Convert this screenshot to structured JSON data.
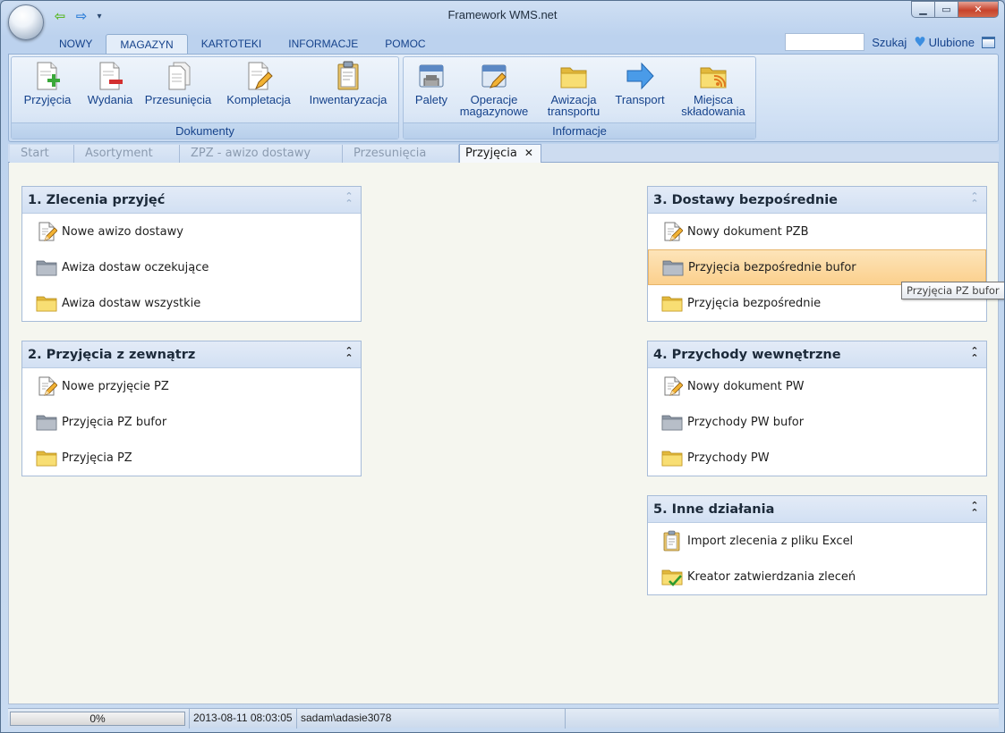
{
  "app": {
    "title": "Framework WMS.net"
  },
  "quick_access": {
    "icons": [
      "back-arrow-icon",
      "forward-arrow-icon"
    ]
  },
  "menu": {
    "tabs": [
      "NOWY",
      "MAGAZYN",
      "KARTOTEKI",
      "INFORMACJE",
      "POMOC"
    ],
    "active_tab": "MAGAZYN"
  },
  "search": {
    "value": "",
    "button_label": "Szukaj",
    "favorites_label": "Ulubione"
  },
  "ribbon": {
    "dokumenty": {
      "label": "Dokumenty",
      "buttons": [
        "Przyjęcia",
        "Wydania",
        "Przesunięcia",
        "Kompletacja",
        "Inwentaryzacja"
      ]
    },
    "informacje": {
      "label": "Informacje",
      "buttons": [
        {
          "line1": "Palety",
          "line2": ""
        },
        {
          "line1": "Operacje",
          "line2": "magazynowe"
        },
        {
          "line1": "Awizacja",
          "line2": "transportu"
        },
        {
          "line1": "Transport",
          "line2": ""
        },
        {
          "line1": "Miejsca",
          "line2": "składowania"
        }
      ]
    }
  },
  "doc_tabs": {
    "tabs": [
      "Start",
      "Asortyment",
      "ZPZ - awizo dostawy",
      "Przesunięcia",
      "Przyjęcia"
    ],
    "active": "Przyjęcia",
    "close_glyph": "✕"
  },
  "cards": {
    "c1": {
      "title": "1. Zlecenia przyjęć",
      "items": [
        "Nowe awizo dostawy",
        "Awiza dostaw oczekujące",
        "Awiza dostaw wszystkie"
      ]
    },
    "c2": {
      "title": "2. Przyjęcia z zewnątrz",
      "items": [
        "Nowe przyjęcie PZ",
        "Przyjęcia PZ bufor",
        "Przyjęcia PZ"
      ]
    },
    "c3": {
      "title": "3. Dostawy bezpośrednie",
      "items": [
        "Nowy dokument PZB",
        "Przyjęcia bezpośrednie bufor",
        "Przyjęcia bezpośrednie"
      ]
    },
    "c4": {
      "title": "4. Przychody wewnętrzne",
      "items": [
        "Nowy dokument PW",
        "Przychody PW bufor",
        "Przychody PW"
      ]
    },
    "c5": {
      "title": "5. Inne działania",
      "items": [
        "Import zlecenia z pliku Excel",
        "Kreator zatwierdzania zleceń"
      ]
    }
  },
  "tooltip": "Przyjęcia PZ bufor",
  "status": {
    "progress_text": "0%",
    "progress_value": 0,
    "datetime": "2013-08-11 08:03:05",
    "user": "sadam\\adasie3078"
  },
  "colors": {
    "accent": "#15428b",
    "hover": "#fbd08d",
    "folder_yellow": "#f5d85a",
    "folder_gray": "#9aa3ae"
  }
}
